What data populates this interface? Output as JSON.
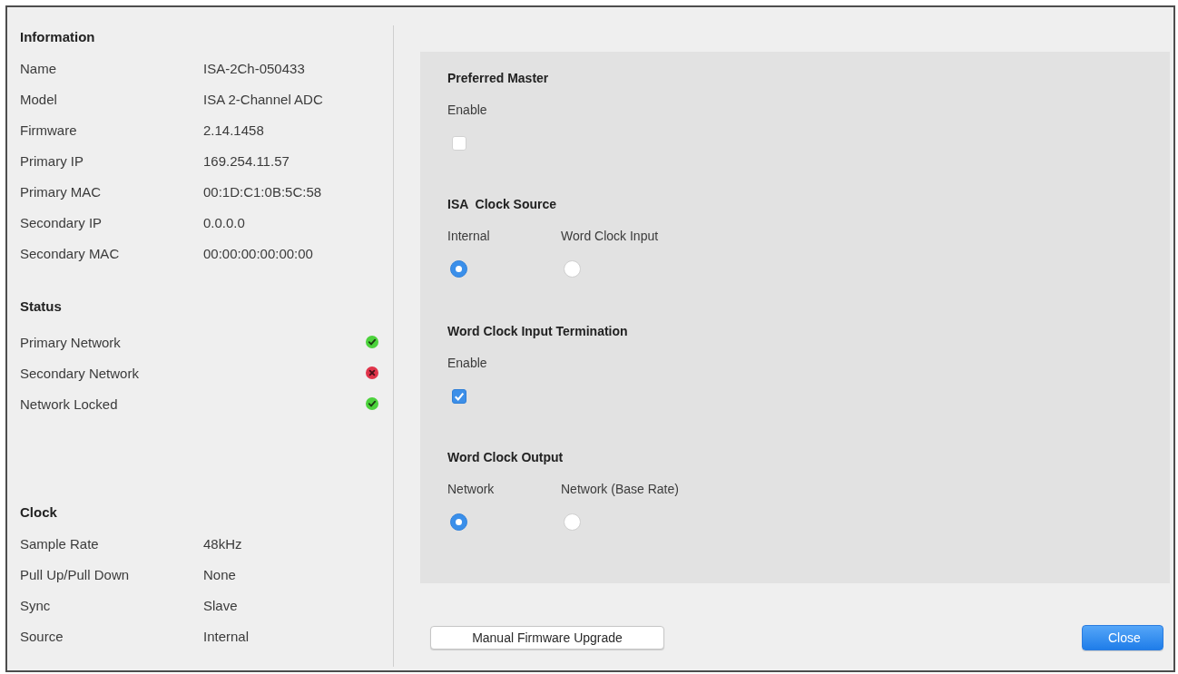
{
  "information": {
    "heading": "Information",
    "rows": [
      {
        "label": "Name",
        "value": "ISA-2Ch-050433"
      },
      {
        "label": "Model",
        "value": "ISA 2-Channel ADC"
      },
      {
        "label": "Firmware",
        "value": "2.14.1458"
      },
      {
        "label": "Primary IP",
        "value": "169.254.11.57"
      },
      {
        "label": "Primary MAC",
        "value": "00:1D:C1:0B:5C:58"
      },
      {
        "label": "Secondary IP",
        "value": "0.0.0.0"
      },
      {
        "label": "Secondary MAC",
        "value": "00:00:00:00:00:00"
      }
    ]
  },
  "status": {
    "heading": "Status",
    "rows": [
      {
        "label": "Primary Network",
        "ok": true
      },
      {
        "label": "Secondary Network",
        "ok": false
      },
      {
        "label": "Network Locked",
        "ok": true
      }
    ]
  },
  "clock": {
    "heading": "Clock",
    "rows": [
      {
        "label": "Sample Rate",
        "value": "48kHz"
      },
      {
        "label": "Pull Up/Pull Down",
        "value": "None"
      },
      {
        "label": "Sync",
        "value": "Slave"
      },
      {
        "label": "Source",
        "value": "Internal"
      }
    ]
  },
  "settings": [
    {
      "kind": "checkbox",
      "title": "Preferred Master",
      "label": "Enable",
      "checked": false
    },
    {
      "kind": "radio",
      "title": "ISA  Clock Source",
      "options": [
        {
          "label": "Internal",
          "selected": true
        },
        {
          "label": "Word Clock Input",
          "selected": false
        }
      ]
    },
    {
      "kind": "checkbox",
      "title": "Word Clock Input Termination",
      "label": "Enable",
      "checked": true
    },
    {
      "kind": "radio",
      "title": "Word Clock Output",
      "options": [
        {
          "label": "Network",
          "selected": true
        },
        {
          "label": "Network (Base Rate)",
          "selected": false
        }
      ]
    }
  ],
  "buttons": [
    {
      "label": "Manual Firmware Upgrade",
      "kind": "default"
    },
    {
      "label": "Close",
      "kind": "primary"
    }
  ]
}
